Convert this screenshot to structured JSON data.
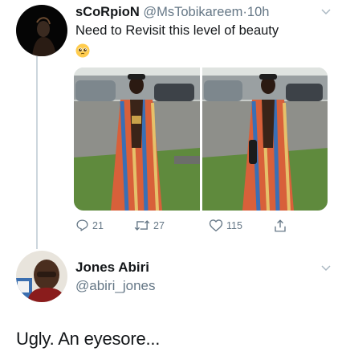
{
  "tweet": {
    "author_name": "sCoRpioN",
    "author_handle": "@MsTobikareem",
    "separator": "·",
    "time": "10h",
    "text": "Need to Revisit this level of beauty",
    "emoji": "pleading-face-emoji",
    "media_count": 2,
    "actions": {
      "reply_count": "21",
      "retweet_count": "27",
      "like_count": "115"
    }
  },
  "reply": {
    "author_name": "Jones Abiri",
    "author_handle": "@abiri_jones",
    "text": "Ugly. An eyesore..."
  },
  "colors": {
    "text_primary": "#14171a",
    "text_secondary": "#657786",
    "thread_line": "#ccd6dd"
  },
  "icons": [
    "reply-icon",
    "retweet-icon",
    "like-icon",
    "share-icon",
    "chevron-down-icon"
  ]
}
